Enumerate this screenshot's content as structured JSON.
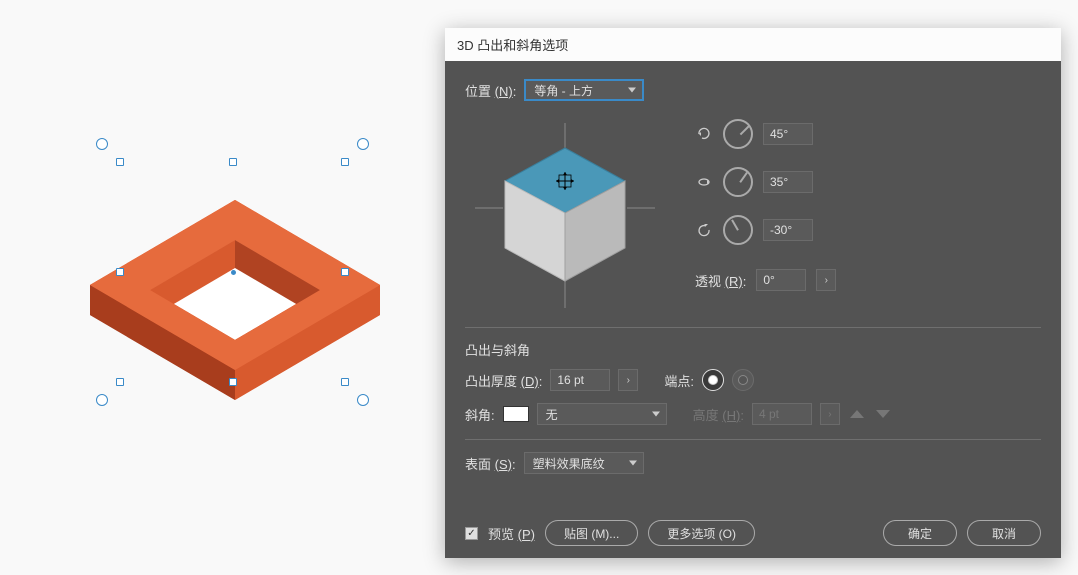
{
  "dialog": {
    "title": "3D 凸出和斜角选项",
    "position": {
      "label": "位置",
      "shortcut": "(N)",
      "colon": ":",
      "value": "等角 - 上方"
    },
    "rotation": {
      "x_value": "45°",
      "y_value": "35°",
      "z_value": "-30°"
    },
    "perspective": {
      "label": "透视",
      "shortcut": "(R)",
      "colon": ":",
      "value": "0°"
    },
    "extrude_section": {
      "title": "凸出与斜角",
      "depth_label": "凸出厚度",
      "depth_shortcut": "(D)",
      "depth_colon": ":",
      "depth_value": "16 pt",
      "cap_label": "端点:"
    },
    "bevel": {
      "label": "斜角:",
      "value": "无",
      "height_label": "高度",
      "height_shortcut": "(H)",
      "height_colon": ":",
      "height_value": "4 pt"
    },
    "surface": {
      "label": "表面",
      "shortcut": "(S)",
      "colon": ":",
      "value": "塑料效果底纹"
    },
    "footer": {
      "preview_label": "预览",
      "preview_shortcut": "(P)",
      "map_art": "贴图 (M)...",
      "more_options": "更多选项 (O)",
      "ok": "确定",
      "cancel": "取消"
    }
  },
  "colors": {
    "shape_orange": "#d85a2e",
    "shape_orange_dark": "#b04322",
    "shape_orange_light": "#e66b3d",
    "cube_top": "#4a98b8",
    "cube_left": "#d5d5d5",
    "cube_right": "#bababa"
  }
}
